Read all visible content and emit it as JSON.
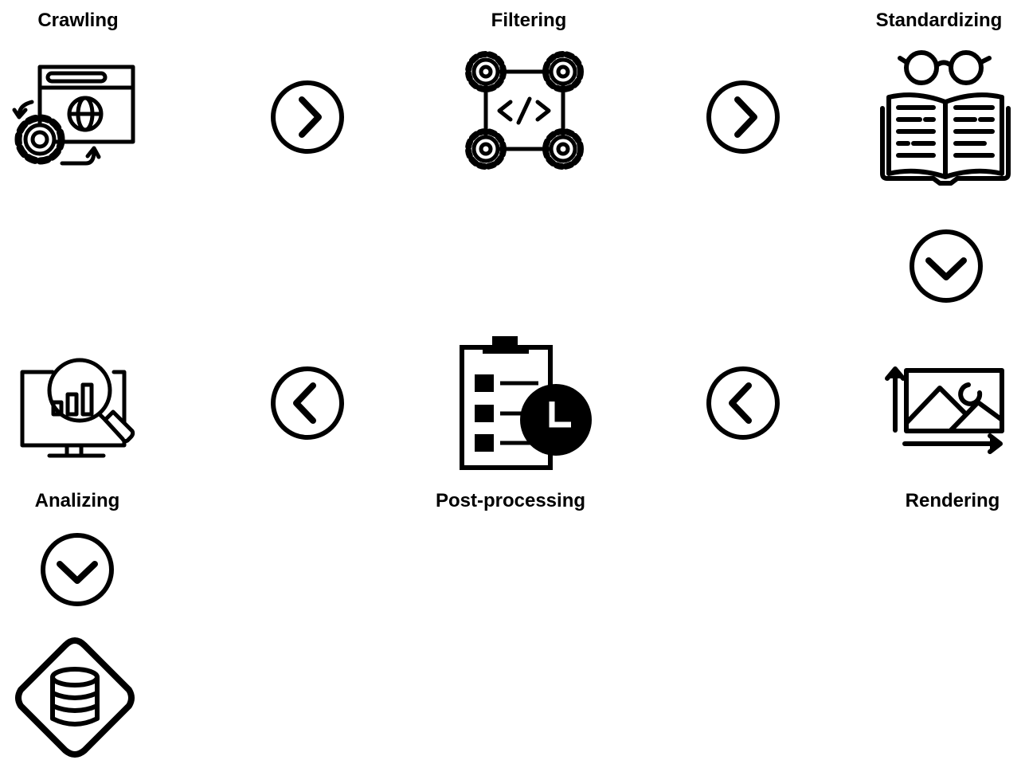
{
  "steps": {
    "crawling": {
      "label": "Crawling",
      "icon": "web-crawler-icon"
    },
    "filtering": {
      "label": "Filtering",
      "icon": "code-network-icon"
    },
    "standardizing": {
      "label": "Standardizing",
      "icon": "book-glasses-icon"
    },
    "rendering": {
      "label": "Rendering",
      "icon": "image-chart-icon"
    },
    "post_processing": {
      "label": "Post-processing",
      "icon": "clipboard-clock-icon"
    },
    "analizing": {
      "label": "Analizing",
      "icon": "monitor-analysis-icon"
    },
    "database": {
      "label": "",
      "icon": "database-diamond-icon"
    }
  },
  "arrows": [
    {
      "from": "crawling",
      "to": "filtering",
      "icon": "chevron-right-circle-icon"
    },
    {
      "from": "filtering",
      "to": "standardizing",
      "icon": "chevron-right-circle-icon"
    },
    {
      "from": "standardizing",
      "to": "rendering",
      "icon": "chevron-down-circle-icon"
    },
    {
      "from": "rendering",
      "to": "post_processing",
      "icon": "chevron-left-circle-icon"
    },
    {
      "from": "post_processing",
      "to": "analizing",
      "icon": "chevron-left-circle-icon"
    },
    {
      "from": "analizing",
      "to": "database",
      "icon": "chevron-down-circle-icon"
    }
  ],
  "colors": {
    "stroke": "#000000",
    "background": "#ffffff"
  }
}
